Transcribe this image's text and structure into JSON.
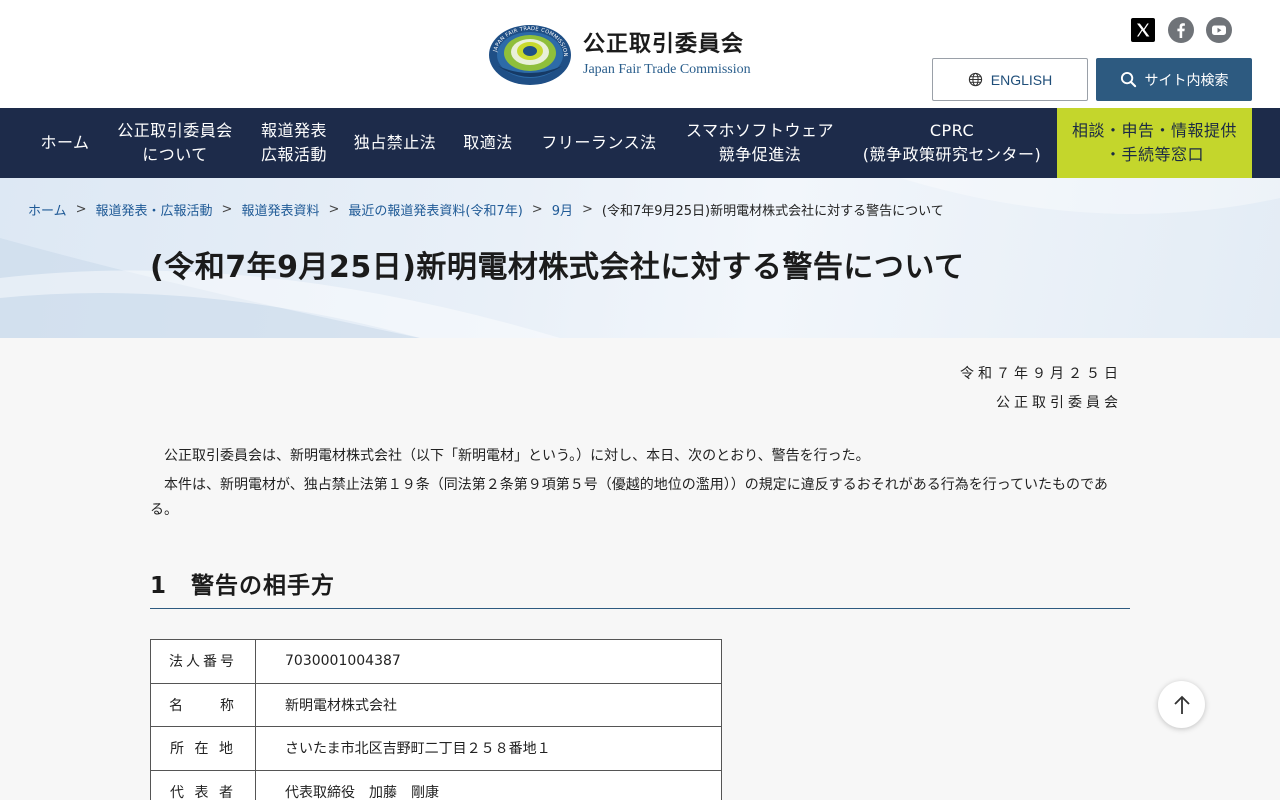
{
  "header": {
    "logo_ja": "公正取引委員会",
    "logo_en": "Japan Fair Trade Commission",
    "logo_ring_text": "JAPAN FAIR TRADE COMMISSION",
    "sns": [
      {
        "name": "x-icon"
      },
      {
        "name": "facebook-icon"
      },
      {
        "name": "youtube-icon"
      }
    ],
    "english_label": "ENGLISH",
    "search_label": "サイト内検索"
  },
  "nav": [
    {
      "label": "ホーム"
    },
    {
      "label": "公正取引委員会\nについて"
    },
    {
      "label": "報道発表\n広報活動"
    },
    {
      "label": "独占禁止法"
    },
    {
      "label": "取適法"
    },
    {
      "label": "フリーランス法"
    },
    {
      "label": "スマホソフトウェア\n競争促進法"
    },
    {
      "label": "CPRC\n(競争政策研究センター)"
    },
    {
      "label": "相談・申告・情報提供\n・手続等窓口"
    }
  ],
  "breadcrumb": {
    "items": [
      "ホーム",
      "報道発表・広報活動",
      "報道発表資料",
      "最近の報道発表資料(令和7年)",
      "9月"
    ],
    "current": "(令和7年9月25日)新明電材株式会社に対する警告について",
    "separator": ">"
  },
  "page_title": "(令和7年9月25日)新明電材株式会社に対する警告について",
  "document": {
    "date": "令和７年９月２５日",
    "issuer": "公正取引委員会",
    "paragraph1": "公正取引委員会は、新明電材株式会社（以下「新明電材」という。）に対し、本日、次のとおり、警告を行った。",
    "paragraph2": "本件は、新明電材が、独占禁止法第１９条（同法第２条第９項第５号（優越的地位の濫用））の規定に違反するおそれがある行為を行っていたものである。",
    "section1_title": "1　警告の相手方",
    "table": [
      {
        "label": "法人番号",
        "value": "7030001004387"
      },
      {
        "label": "名　　称",
        "value": "新明電材株式会社"
      },
      {
        "label": "所 在 地",
        "value": "さいたま市北区吉野町二丁目２５８番地１"
      },
      {
        "label": "代 表 者",
        "value": "代表取締役　加藤　剛康"
      }
    ]
  },
  "back_to_top": "arrow-up-icon",
  "colors": {
    "nav_bg": "#1d2b4a",
    "consult_bg": "#c4d62c",
    "search_bg": "#2d5a80",
    "link": "#1f5a96"
  }
}
